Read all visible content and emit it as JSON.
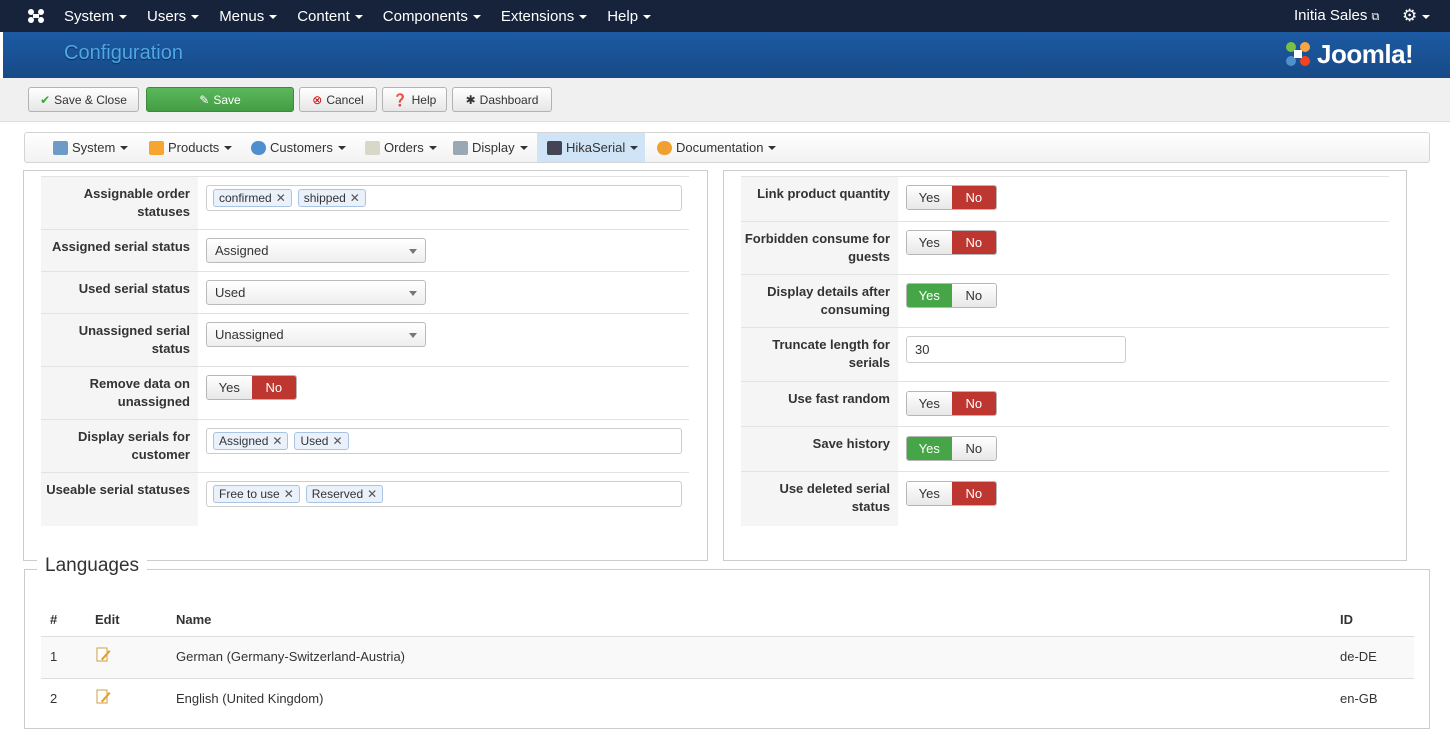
{
  "topnav": {
    "menu": [
      "System",
      "Users",
      "Menus",
      "Content",
      "Components",
      "Extensions",
      "Help"
    ],
    "user": "Initia Sales"
  },
  "header": {
    "title": "Configuration",
    "brand": "Joomla!"
  },
  "toolbar": {
    "save_close": "Save & Close",
    "save": "Save",
    "cancel": "Cancel",
    "help": "Help",
    "dashboard": "Dashboard"
  },
  "tabs": [
    "System",
    "Products",
    "Customers",
    "Orders",
    "Display",
    "HikaSerial",
    "Documentation"
  ],
  "left": {
    "assignable_label": "Assignable order statuses",
    "assignable_tags": [
      "confirmed",
      "shipped"
    ],
    "assigned_label": "Assigned serial status",
    "assigned_value": "Assigned",
    "used_label": "Used serial status",
    "used_value": "Used",
    "unassigned_label": "Unassigned serial status",
    "unassigned_value": "Unassigned",
    "remove_label": "Remove data on unassigned",
    "remove_value": "No",
    "display_label": "Display serials for customer",
    "display_tags": [
      "Assigned",
      "Used"
    ],
    "useable_label": "Useable serial statuses",
    "useable_tags": [
      "Free to use",
      "Reserved"
    ]
  },
  "right": {
    "link_label": "Link product quantity",
    "link_value": "No",
    "forbidden_label": "Forbidden consume for guests",
    "forbidden_value": "No",
    "display_details_label": "Display details after consuming",
    "display_details_value": "Yes",
    "truncate_label": "Truncate length for serials",
    "truncate_value": "30",
    "fast_random_label": "Use fast random",
    "fast_random_value": "No",
    "save_history_label": "Save history",
    "save_history_value": "Yes",
    "deleted_label": "Use deleted serial status",
    "deleted_value": "No"
  },
  "yes_label": "Yes",
  "no_label": "No",
  "languages": {
    "legend": "Languages",
    "headers": [
      "#",
      "Edit",
      "Name",
      "ID"
    ],
    "rows": [
      {
        "num": "1",
        "name": "German (Germany-Switzerland-Austria)",
        "id": "de-DE"
      },
      {
        "num": "2",
        "name": "English (United Kingdom)",
        "id": "en-GB"
      }
    ]
  },
  "colors": {
    "nav": "#17233b",
    "header": "#1c5aa3",
    "no_active": "#bd362f",
    "yes_active": "#46a546",
    "save_button": "#5cb85c"
  }
}
